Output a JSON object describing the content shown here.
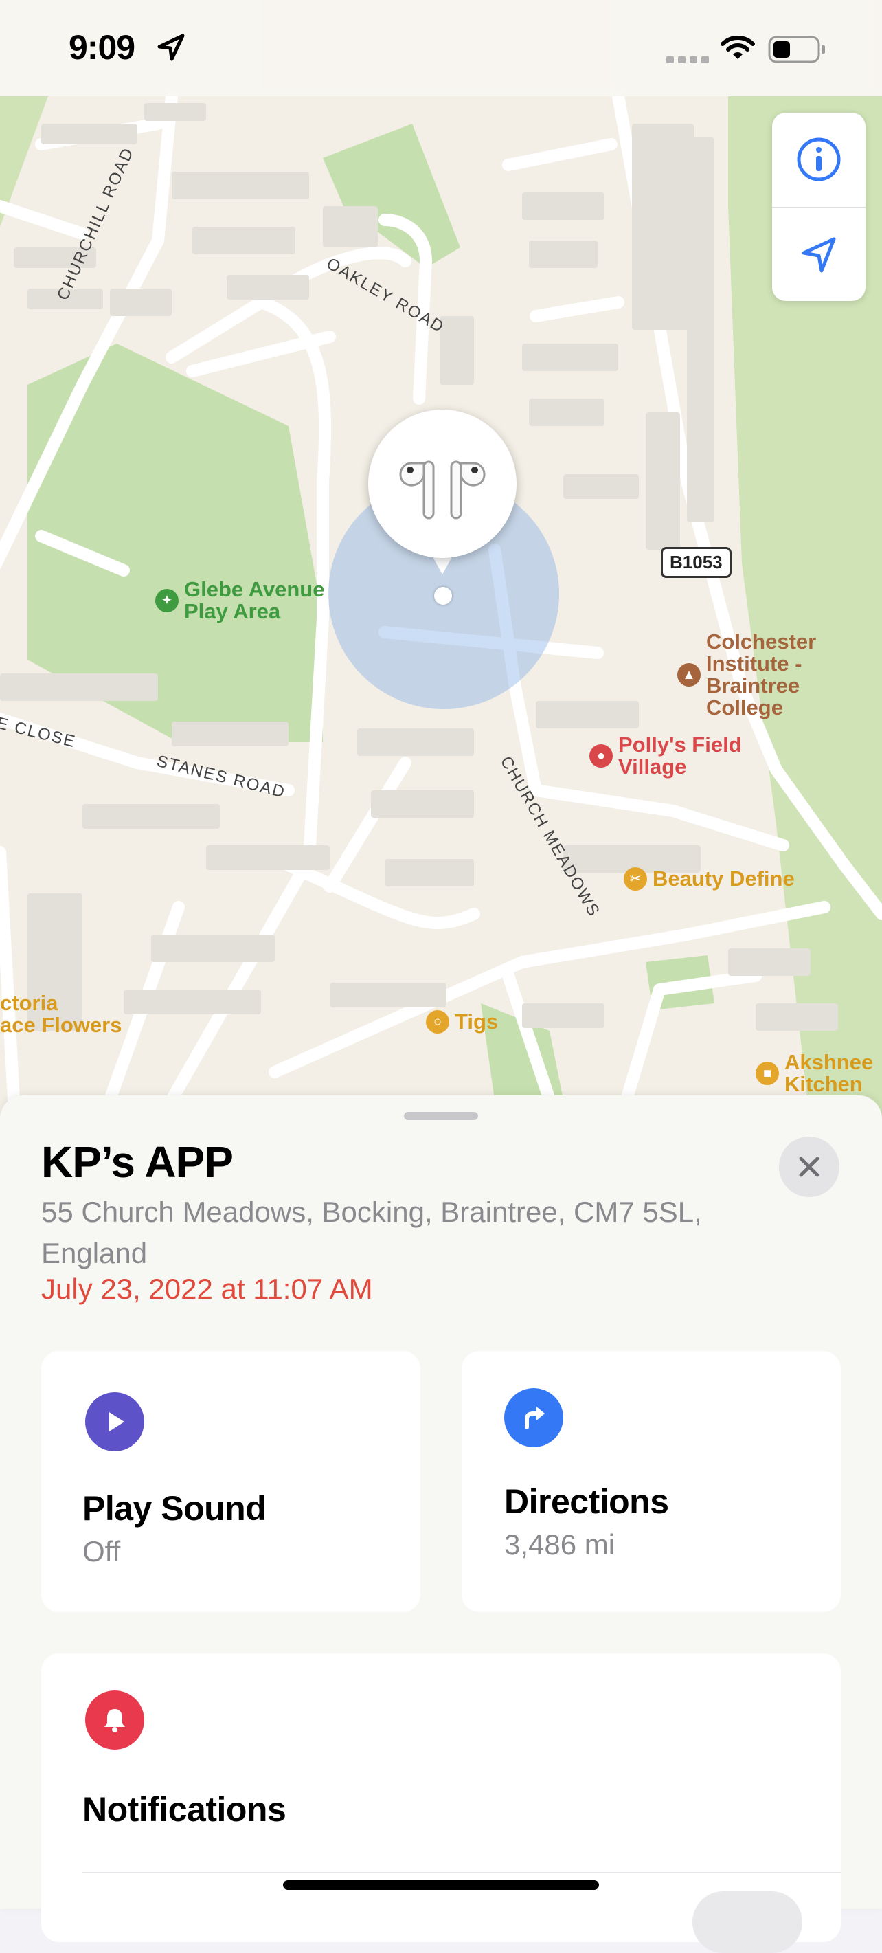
{
  "status_bar": {
    "time": "9:09",
    "location_icon": "location-arrow-icon",
    "signal_icon": "cellular-signal-icon",
    "wifi_icon": "wifi-icon",
    "battery_icon": "battery-icon"
  },
  "map": {
    "controls": {
      "info_icon": "info-icon",
      "locate_icon": "location-arrow-icon"
    },
    "streets": {
      "churchill_road": "CHURCHILL ROAD",
      "oakley_road": "OAKLEY ROAD",
      "the_close": "THE CLOSE",
      "stanes_road": "STANES ROAD",
      "church_meadows": "CHURCH MEADOWS"
    },
    "road_badge": "B1053",
    "pois": {
      "glebe": "Glebe Avenue\nPlay Area",
      "colchester": "Colchester\nInstitute -\nBraintree\nCollege",
      "pollys": "Polly's Field\nVillage",
      "beauty": "Beauty Define",
      "tigs": "Tigs",
      "victoria": "ctoria\nace Flowers",
      "akshnee": "Akshnee\nKitchen"
    },
    "device_icon": "airpods-icon"
  },
  "sheet": {
    "device_name": "KP’s APP",
    "address": "55 Church Meadows, Bocking, Braintree, CM7 5SL, England",
    "timestamp": "July 23, 2022 at 11:07 AM",
    "play_sound": {
      "title": "Play Sound",
      "status": "Off",
      "icon": "play-icon"
    },
    "directions": {
      "title": "Directions",
      "distance": "3,486 mi",
      "icon": "turn-right-arrow-icon"
    },
    "notifications": {
      "title": "Notifications",
      "icon": "bell-icon"
    }
  },
  "colors": {
    "accent_blue": "#3478f6",
    "play_purple": "#5e52c8",
    "bell_red": "#e8394d",
    "timestamp_red": "#e0493c"
  }
}
